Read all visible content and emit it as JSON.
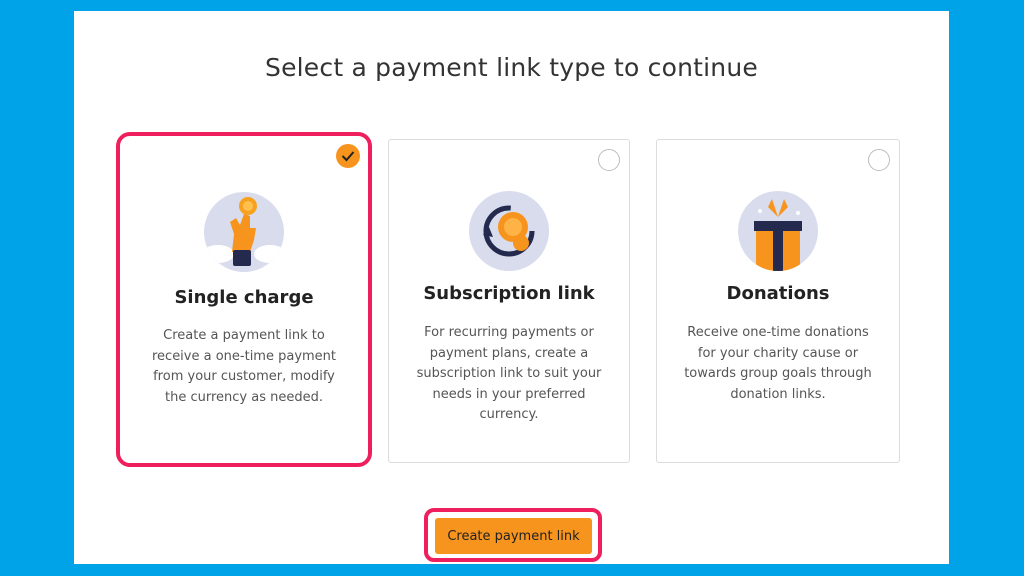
{
  "page": {
    "title": "Select a payment link type to continue"
  },
  "colors": {
    "accent": "#f7941d",
    "highlight": "#ee1f5c",
    "background": "#00a3e8"
  },
  "cards": [
    {
      "title": "Single charge",
      "description": "Create a payment link to receive a one-time payment from your customer, modify the currency as needed.",
      "selected": true,
      "icon": "hand-coin-icon"
    },
    {
      "title": "Subscription link",
      "description": "For recurring payments or payment plans, create a subscription link to suit your needs in your preferred currency.",
      "selected": false,
      "icon": "recurring-coin-icon"
    },
    {
      "title": "Donations",
      "description": "Receive one-time donations for your charity cause or towards group goals through donation links.",
      "selected": false,
      "icon": "gift-icon"
    }
  ],
  "actions": {
    "create_label": "Create payment link"
  }
}
